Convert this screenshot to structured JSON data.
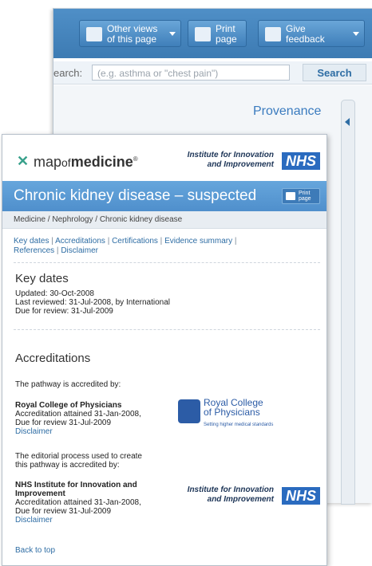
{
  "back": {
    "toolbar": {
      "other_views": "Other views\nof this page",
      "print": "Print\npage",
      "feedback": "Give\nfeedback"
    },
    "search": {
      "label": "earch:",
      "placeholder": "(e.g. asthma or \"chest pain\")",
      "button": "Search"
    },
    "provenance": "Provenance"
  },
  "front": {
    "brand": {
      "map": "map",
      "of": "of",
      "medicine": "medicine",
      "reg": "®",
      "institute": "Institute for Innovation\nand Improvement",
      "nhs": "NHS"
    },
    "title": "Chronic kidney disease – suspected",
    "print_mini": "Print\npage",
    "breadcrumb": "Medicine  /  Nephrology  /  Chronic kidney disease",
    "links": [
      "Key dates",
      "Accreditations",
      "Certifications",
      "Evidence summary",
      "References",
      "Disclaimer"
    ],
    "key_dates": {
      "heading": "Key dates",
      "updated": "Updated: 30-Oct-2008",
      "last_reviewed": "Last reviewed: 31-Jul-2008, by International",
      "due": "Due for review: 31-Jul-2009"
    },
    "accreditations": {
      "heading": "Accreditations",
      "intro": "The pathway is accredited by:",
      "rcp_name": "Royal College of Physicians",
      "rcp_details": "Accreditation attained 31-Jan-2008,\nDue for review 31-Jul-2009",
      "rcp_disclaimer": "Disclaimer",
      "rcp_logo": "Royal College\nof Physicians",
      "rcp_tagline": "Setting higher medical standards",
      "editorial": "The editorial process used to create\nthis pathway is accredited by:",
      "nhs_name": "NHS Institute for Innovation and\nImprovement",
      "nhs_details": "Accreditation attained 31-Jan-2008,\nDue for review 31-Jul-2009",
      "nhs_disclaimer": "Disclaimer",
      "nhs_logo_text": "Institute for Innovation\nand Improvement",
      "nhs_logo": "NHS"
    },
    "back_to_top": "Back to top"
  }
}
